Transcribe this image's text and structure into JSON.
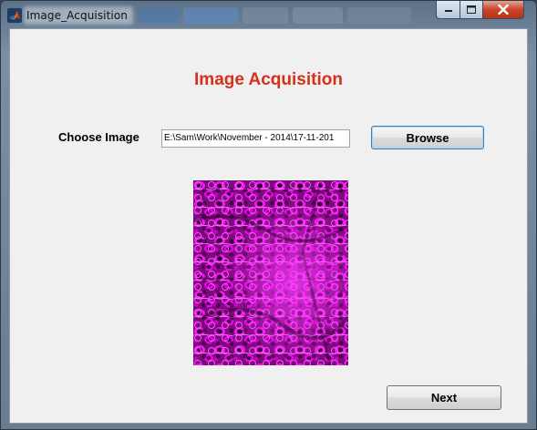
{
  "window": {
    "title": "Image_Acquisition",
    "app_icon": "matlab-icon",
    "controls": [
      "minimize-icon",
      "maximize-icon",
      "close-icon"
    ]
  },
  "main": {
    "heading": "Image Acquisition",
    "choose_label": "Choose Image",
    "path_value": "E:\\Sam\\Work\\November - 2014\\17-11-201",
    "browse_label": "Browse",
    "next_label": "Next",
    "image_icon": "microscopy-image"
  },
  "colors": {
    "heading": "#d6301a",
    "image_tint": "#ff00ff"
  }
}
